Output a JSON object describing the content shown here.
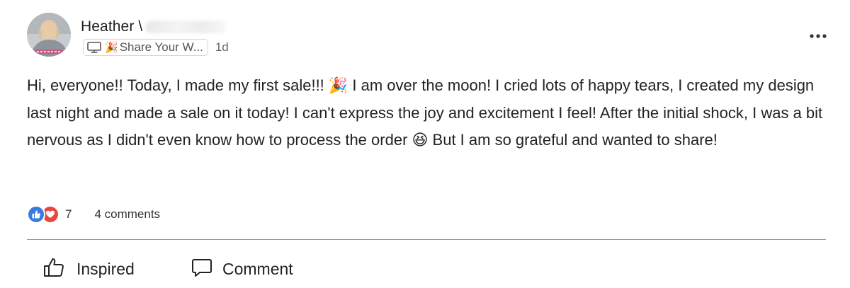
{
  "post": {
    "author": {
      "name": "Heather \\"
    },
    "group_chip": {
      "icon": "monitor-icon",
      "emoji": "🎉",
      "label": "Share Your W..."
    },
    "timestamp": "1d",
    "body": "Hi, everyone!! Today, I made my first sale!!! 🎉 I am over the moon! I cried lots of happy tears, I created my design last night and made a sale on it today! I can't express the joy and excitement I feel! After the initial shock, I was a bit nervous as I didn't even know how to process the order 😆 But I am so grateful and wanted to share!",
    "reactions": {
      "icons": [
        "thumbs-up-icon",
        "heart-icon"
      ],
      "colors": {
        "like": "#3b7be0",
        "love": "#e8463b"
      },
      "count": "7"
    },
    "comments_label": "4 comments",
    "actions": {
      "inspired_label": "Inspired",
      "comment_label": "Comment"
    }
  }
}
